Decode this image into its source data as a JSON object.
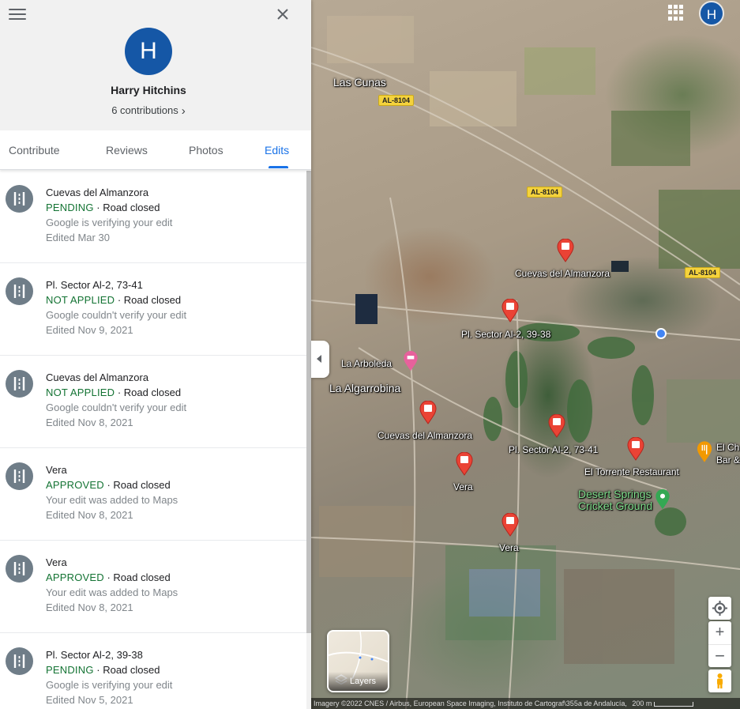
{
  "profile": {
    "avatar_letter": "H",
    "name": "Harry Hitchins",
    "contributions": "6 contributions",
    "contributions_chevron": "›"
  },
  "tabs": [
    {
      "label": "Contribute"
    },
    {
      "label": "Reviews"
    },
    {
      "label": "Photos"
    },
    {
      "label": "Edits",
      "active": true
    }
  ],
  "edits": [
    {
      "place": "Cuevas del Almanzora",
      "status": "PENDING",
      "type": "Road closed",
      "note": "Google is verifying your edit",
      "date": "Edited Mar 30"
    },
    {
      "place": "Pl. Sector Al-2, 73-41",
      "status": "NOT APPLIED",
      "type": "Road closed",
      "note": "Google couldn't verify your edit",
      "date": "Edited Nov 9, 2021"
    },
    {
      "place": "Cuevas del Almanzora",
      "status": "NOT APPLIED",
      "type": "Road closed",
      "note": "Google couldn't verify your edit",
      "date": "Edited Nov 8, 2021"
    },
    {
      "place": "Vera",
      "status": "APPROVED",
      "type": "Road closed",
      "note": "Your edit was added to Maps",
      "date": "Edited Nov 8, 2021"
    },
    {
      "place": "Vera",
      "status": "APPROVED",
      "type": "Road closed",
      "note": "Your edit was added to Maps",
      "date": "Edited Nov 8, 2021"
    },
    {
      "place": "Pl. Sector Al-2, 39-38",
      "status": "PENDING",
      "type": "Road closed",
      "note": "Google is verifying your edit",
      "date": "Edited Nov 5, 2021"
    }
  ],
  "status_separator": " · ",
  "map": {
    "labels": {
      "las_cunas": "Las Cunas",
      "la_arboleda": "La Arboleda",
      "la_algarrobina": "La Algarrobina",
      "cuevas_1": "Cuevas del Almanzora",
      "cuevas_2": "Cuevas del Almanzora",
      "sector_39": "Pl. Sector Al-2, 39-38",
      "sector_73": "Pl. Sector Al-2, 73-41",
      "vera_1": "Vera",
      "vera_2": "Vera",
      "el_torrente": "El Torrente Restaurant",
      "desert_springs": "Desert Springs Cricket Ground",
      "el_ch": "El Ch",
      "bar": "Bar &"
    },
    "road_badges": [
      "AL-8104",
      "AL-8104",
      "AL-8104"
    ],
    "layers_label": "Layers",
    "avatar_letter": "H",
    "zoom_in": "+",
    "zoom_out": "−",
    "attribution": "Imagery ©2022 CNES / Airbus, European Space Imaging, Instituto de Cartograf\\355a de Andalucía,",
    "scale": "200 m"
  }
}
